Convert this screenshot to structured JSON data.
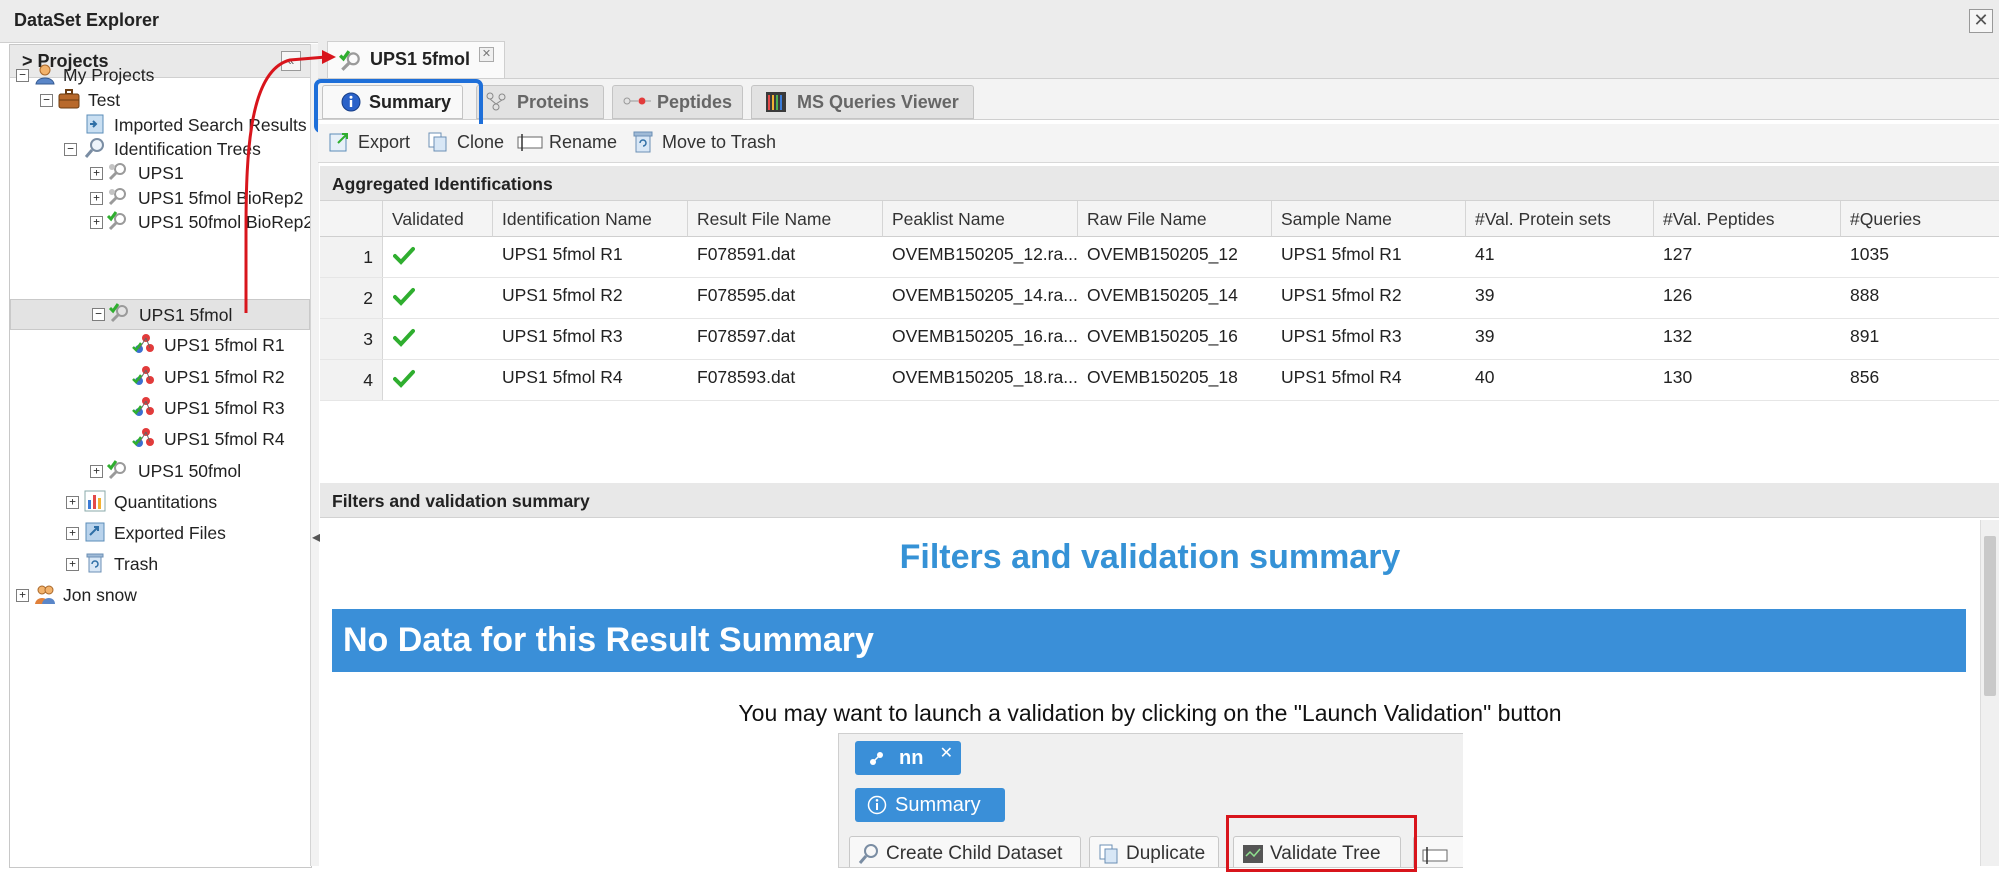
{
  "window": {
    "title": "DataSet Explorer",
    "close_glyph": "✕"
  },
  "left_panel": {
    "title": "> Projects",
    "collapse_glyph": "«",
    "tree": [
      {
        "label": "My Projects",
        "toggle": "−",
        "icon": "user-icon"
      },
      {
        "label": "Test",
        "toggle": "−",
        "icon": "briefcase-icon"
      },
      {
        "label": "Imported Search Results",
        "toggle": "",
        "icon": "imported-results-icon"
      },
      {
        "label": "Identification Trees",
        "toggle": "−",
        "icon": "magnifier-icon"
      },
      {
        "label": "UPS1",
        "toggle": "+",
        "icon": "dataset-grey-icon"
      },
      {
        "label": "UPS1 5fmol BioRep2",
        "toggle": "+",
        "icon": "dataset-grey-icon"
      },
      {
        "label": "UPS1 50fmol BioRep2",
        "toggle": "+",
        "icon": "dataset-validated-icon"
      },
      {
        "label": "UPS1 5fmol",
        "toggle": "−",
        "icon": "dataset-validated-icon"
      },
      {
        "label": "UPS1 5fmol R1",
        "toggle": "",
        "icon": "molecule-icon"
      },
      {
        "label": "UPS1 5fmol R2",
        "toggle": "",
        "icon": "molecule-icon"
      },
      {
        "label": "UPS1 5fmol R3",
        "toggle": "",
        "icon": "molecule-icon"
      },
      {
        "label": "UPS1 5fmol R4",
        "toggle": "",
        "icon": "molecule-icon"
      },
      {
        "label": "UPS1 50fmol",
        "toggle": "+",
        "icon": "dataset-validated-icon"
      },
      {
        "label": "Quantitations",
        "toggle": "+",
        "icon": "bar-chart-icon"
      },
      {
        "label": "Exported Files",
        "toggle": "+",
        "icon": "exported-files-icon"
      },
      {
        "label": "Trash",
        "toggle": "+",
        "icon": "trash-icon"
      },
      {
        "label": "Jon snow",
        "toggle": "+",
        "icon": "users-icon"
      }
    ]
  },
  "doc_tab": {
    "label": "UPS1 5fmol",
    "close_glyph": "✕"
  },
  "sub_tabs": [
    {
      "label": "Summary",
      "icon": "info-icon"
    },
    {
      "label": "Proteins",
      "icon": "proteins-icon"
    },
    {
      "label": "Peptides",
      "icon": "peptides-icon"
    },
    {
      "label": "MS Queries Viewer",
      "icon": "ms-queries-icon"
    }
  ],
  "toolbar": [
    {
      "label": "Export",
      "icon": "export-icon"
    },
    {
      "label": "Clone",
      "icon": "clone-icon"
    },
    {
      "label": "Rename",
      "icon": "rename-icon"
    },
    {
      "label": "Move to Trash",
      "icon": "trash-icon"
    }
  ],
  "aggregated": {
    "title": "Aggregated Identifications",
    "columns": [
      "",
      "Validated",
      "Identification Name",
      "Result File Name",
      "Peaklist Name",
      "Raw File Name",
      "Sample Name",
      "#Val. Protein sets",
      "#Val. Peptides",
      "#Queries"
    ],
    "rows": [
      {
        "num": "1",
        "ident": "UPS1 5fmol R1",
        "result": "F078591.dat",
        "peaklist": "OVEMB150205_12.ra...",
        "raw": "OVEMB150205_12",
        "sample": "UPS1 5fmol R1",
        "protein_sets": "41",
        "peptides": "127",
        "queries": "1035"
      },
      {
        "num": "2",
        "ident": "UPS1 5fmol R2",
        "result": "F078595.dat",
        "peaklist": "OVEMB150205_14.ra...",
        "raw": "OVEMB150205_14",
        "sample": "UPS1 5fmol R2",
        "protein_sets": "39",
        "peptides": "126",
        "queries": "888"
      },
      {
        "num": "3",
        "ident": "UPS1 5fmol R3",
        "result": "F078597.dat",
        "peaklist": "OVEMB150205_16.ra...",
        "raw": "OVEMB150205_16",
        "sample": "UPS1 5fmol R3",
        "protein_sets": "39",
        "peptides": "132",
        "queries": "891"
      },
      {
        "num": "4",
        "ident": "UPS1 5fmol R4",
        "result": "F078593.dat",
        "peaklist": "OVEMB150205_18.ra...",
        "raw": "OVEMB150205_18",
        "sample": "UPS1 5fmol R4",
        "protein_sets": "40",
        "peptides": "130",
        "queries": "856"
      }
    ]
  },
  "filters": {
    "section_title": "Filters and validation summary",
    "heading": "Filters and validation summary",
    "banner": "No Data for this Result Summary",
    "hint": "You may want to launch a validation by clicking on the \"Launch Validation\" button",
    "embedded": {
      "tab_label": "nn",
      "tab_close": "✕",
      "summary_label": "Summary",
      "tools": [
        {
          "label": "Create Child Dataset",
          "icon": "create-child-icon"
        },
        {
          "label": "Duplicate",
          "icon": "duplicate-icon"
        },
        {
          "label": "Validate Tree",
          "icon": "validate-tree-icon"
        }
      ]
    }
  },
  "colors": {
    "accent_blue": "#3a8fd8",
    "heading_blue": "#3592d6",
    "highlight_blue": "#1e6fd9",
    "annotation_red": "#d8151c",
    "check_green": "#2fae2f"
  }
}
